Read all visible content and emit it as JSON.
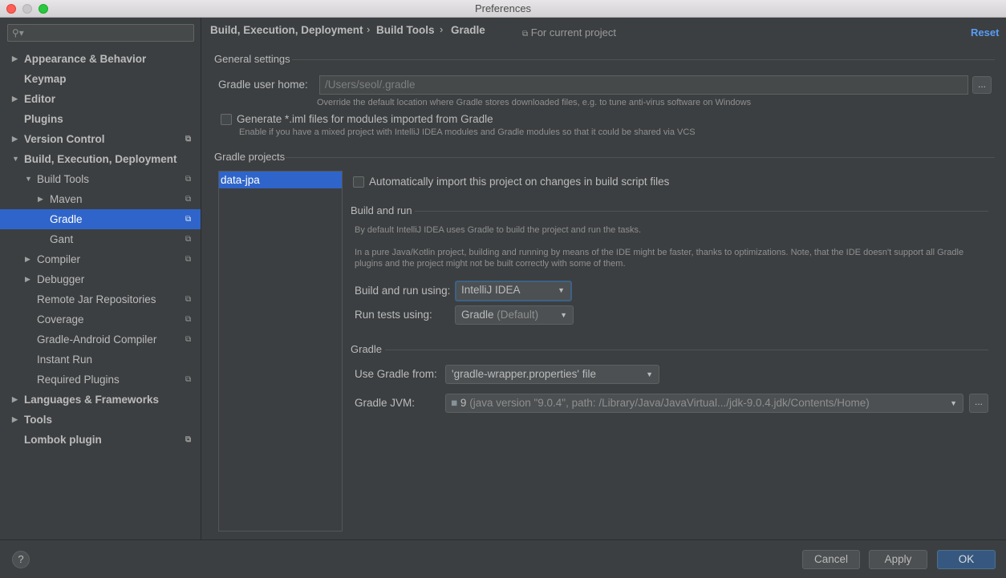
{
  "window": {
    "title": "Preferences"
  },
  "sidebar": {
    "search_placeholder": "",
    "items": [
      {
        "label": "Appearance & Behavior"
      },
      {
        "label": "Keymap"
      },
      {
        "label": "Editor"
      },
      {
        "label": "Plugins"
      },
      {
        "label": "Version Control"
      },
      {
        "label": "Build, Execution, Deployment"
      },
      {
        "label": "Build Tools"
      },
      {
        "label": "Maven"
      },
      {
        "label": "Gradle"
      },
      {
        "label": "Gant"
      },
      {
        "label": "Compiler"
      },
      {
        "label": "Debugger"
      },
      {
        "label": "Remote Jar Repositories"
      },
      {
        "label": "Coverage"
      },
      {
        "label": "Gradle-Android Compiler"
      },
      {
        "label": "Instant Run"
      },
      {
        "label": "Required Plugins"
      },
      {
        "label": "Languages & Frameworks"
      },
      {
        "label": "Tools"
      },
      {
        "label": "Lombok plugin"
      }
    ]
  },
  "header": {
    "breadcrumb": [
      "Build, Execution, Deployment",
      "Build Tools",
      "Gradle"
    ],
    "for_current_project": "For current project",
    "reset": "Reset"
  },
  "general": {
    "title": "General settings",
    "user_home_label": "Gradle user home:",
    "user_home_value": "/Users/seol/.gradle",
    "user_home_hint": "Override the default location where Gradle stores downloaded files, e.g. to tune anti-virus software on Windows",
    "generate_iml_label": "Generate *.iml files for modules imported from Gradle",
    "generate_iml_hint": "Enable if you have a mixed project with IntelliJ IDEA modules and Gradle modules so that it could be shared via VCS"
  },
  "projects": {
    "title": "Gradle projects",
    "items": [
      "data-jpa"
    ],
    "auto_import_label": "Automatically import this project on changes in build script files"
  },
  "build_run": {
    "title": "Build and run",
    "desc1": "By default IntelliJ IDEA uses Gradle to build the project and run the tasks.",
    "desc2_line1": "In a pure Java/Kotlin project, building and running by means of the IDE might be faster, thanks to optimizations. Note, that the IDE doesn't support all Gradle",
    "desc2_line2": "plugins and the project might not be built correctly with some of them.",
    "build_using_label": "Build and run using:",
    "build_using_value": "IntelliJ IDEA",
    "tests_using_label": "Run tests using:",
    "tests_using_value": "Gradle",
    "tests_using_suffix": "(Default)"
  },
  "gradle": {
    "title": "Gradle",
    "use_from_label": "Use Gradle from:",
    "use_from_value": "'gradle-wrapper.properties' file",
    "jvm_label": "Gradle JVM:",
    "jvm_version": "9",
    "jvm_detail": "(java version \"9.0.4\", path: /Library/Java/JavaVirtual.../jdk-9.0.4.jdk/Contents/Home)"
  },
  "footer": {
    "help": "?",
    "cancel": "Cancel",
    "apply": "Apply",
    "ok": "OK"
  },
  "colors": {
    "accent": "#2f65ca",
    "link": "#589df6",
    "background": "#3c3f41",
    "primary_button": "#365880"
  }
}
